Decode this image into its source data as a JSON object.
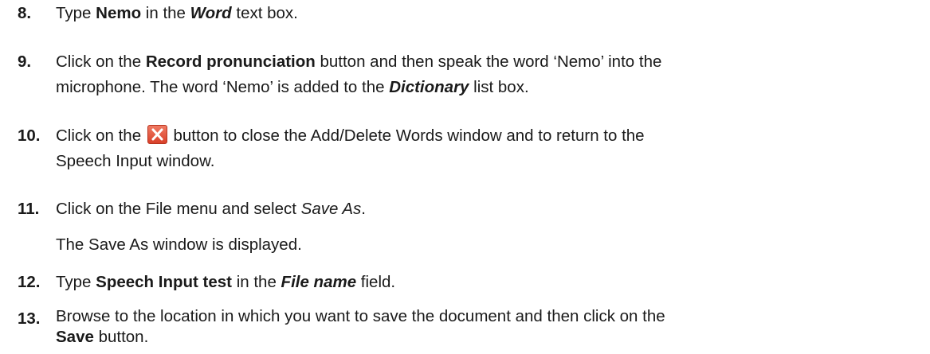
{
  "steps": [
    {
      "num": "8.",
      "parts": {
        "a": "Type ",
        "b": "Nemo",
        "c": " in the ",
        "d": "Word",
        "e": " text box."
      }
    },
    {
      "num": "9.",
      "parts": {
        "a": "Click on the ",
        "b": "Record pronunciation",
        "c": " button and then speak the word ‘Nemo’ into the",
        "d": "microphone. The word ‘Nemo’ is added to the ",
        "e": "Dictionary",
        "f": " list box."
      }
    },
    {
      "num": "10.",
      "parts": {
        "a": "Click on the ",
        "b": " button to close the Add/Delete Words window and to return to the",
        "c": "Speech Input window."
      },
      "icon": "close-icon"
    },
    {
      "num": "11.",
      "parts": {
        "a": "Click on the File menu and select ",
        "b": "Save As",
        "c": "."
      },
      "note": "The Save As window is displayed."
    },
    {
      "num": "12.",
      "parts": {
        "a": "Type ",
        "b": "Speech Input test",
        "c": " in the ",
        "d": "File name",
        "e": " field."
      }
    },
    {
      "num": "13.",
      "parts": {
        "a": "Browse to the location in which you want to save the document and then click on the",
        "b": "Save",
        "c": " button."
      }
    }
  ]
}
